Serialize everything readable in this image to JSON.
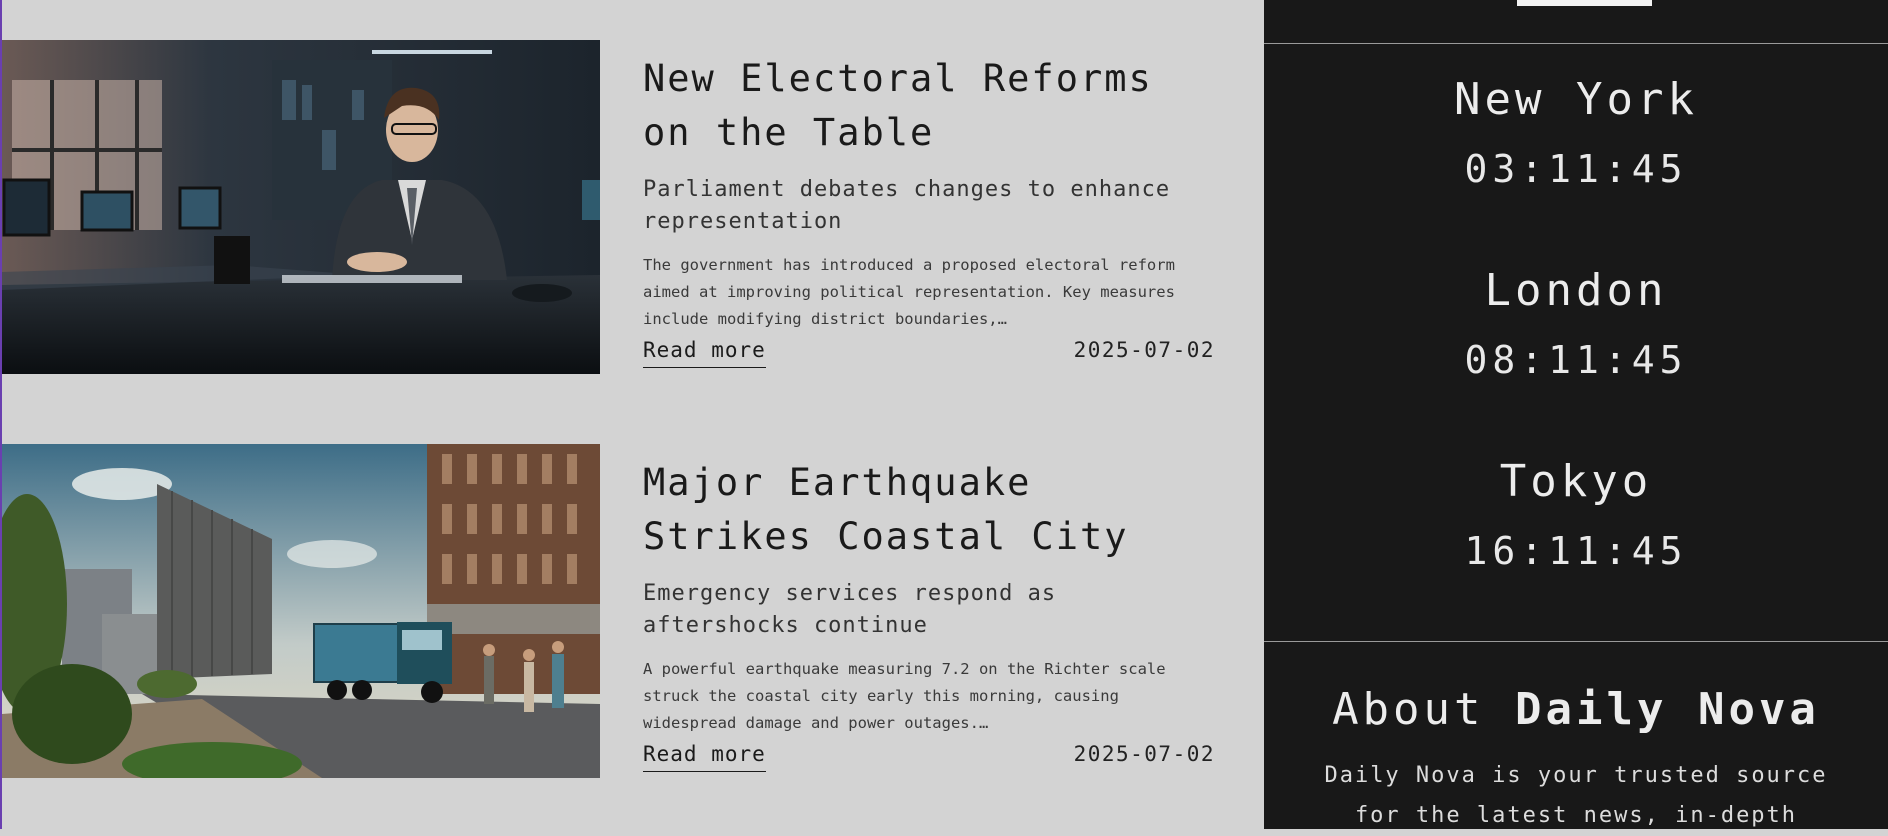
{
  "articles": [
    {
      "title": "New Electoral Reforms on the Table",
      "subtitle": "Parliament debates changes to enhance representation",
      "summary": "The government has introduced a proposed electoral reform aimed at improving political representation. Key measures include modifying district boundaries,…",
      "read_more": "Read more",
      "date": "2025-07-02",
      "image": "man-in-suit-office-photo"
    },
    {
      "title": "Major Earthquake Strikes Coastal City",
      "subtitle": "Emergency services respond as aftershocks continue",
      "summary": "A powerful earthquake measuring 7.2 on the Richter scale struck the coastal city early this morning, causing widespread damage and power outages.…",
      "read_more": "Read more",
      "date": "2025-07-02",
      "image": "city-street-truck-photo"
    }
  ],
  "sidebar": {
    "clocks": [
      {
        "city": "New York",
        "time": "03:11:45"
      },
      {
        "city": "London",
        "time": "08:11:45"
      },
      {
        "city": "Tokyo",
        "time": "16:11:45"
      }
    ],
    "about": {
      "prefix": "About ",
      "brand": "Daily Nova",
      "text": "Daily Nova is your trusted source for the latest news, in-depth"
    }
  },
  "colors": {
    "page_bg": "#d3d3d3",
    "sidebar_bg": "#181818",
    "accent_edge": "#6a3fb0"
  }
}
